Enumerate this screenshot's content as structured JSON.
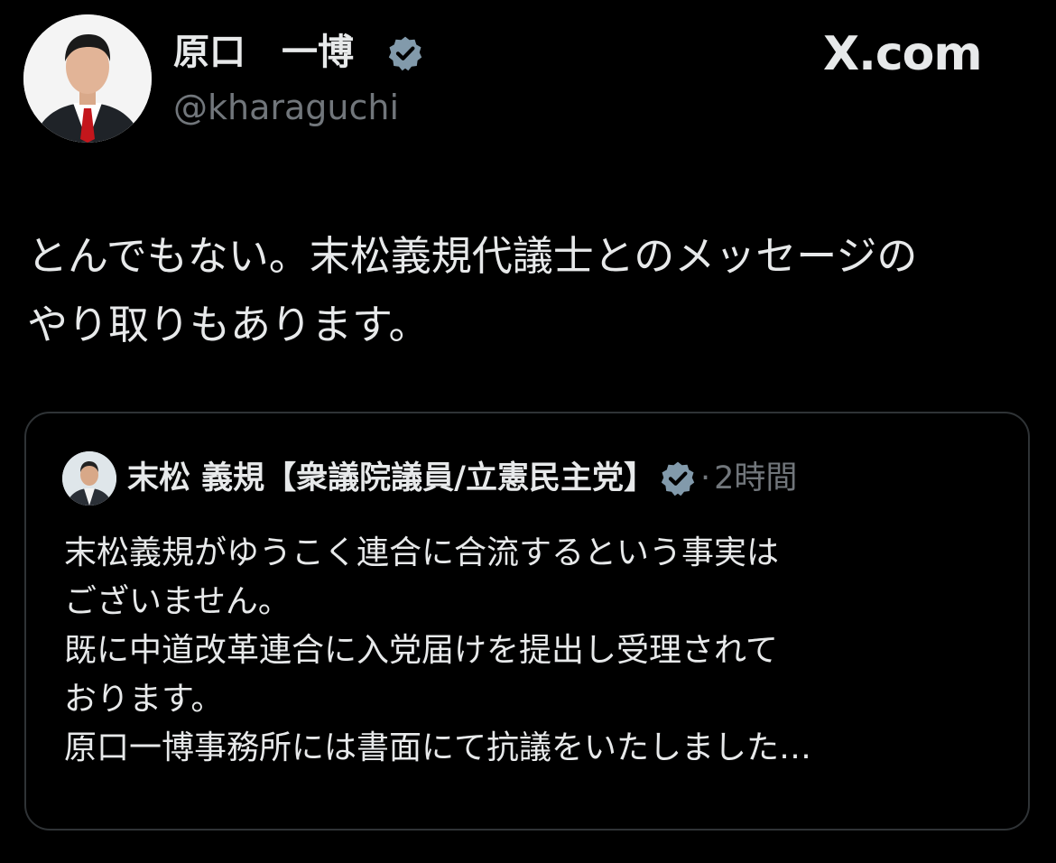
{
  "author": {
    "name": "原口　一博",
    "handle": "@kharaguchi",
    "avatar": "portrait-photo"
  },
  "site": {
    "brand": "X.com"
  },
  "tweet": {
    "text": "とんでもない。末松義規代議士とのメッセージの\nやり取りもあります。"
  },
  "quote": {
    "name": "末松 義規【衆議院議員/立憲民主党】",
    "separator": "·",
    "time": "2時間",
    "avatar": "portrait-photo",
    "body": "末松義規がゆうこく連合に合流するという事実は\nございません。\n既に中道改革連合に入党届けを提出し受理されて\nおります。\n原口一博事務所には書面にて抗議をいたしました…"
  },
  "icons": {
    "verified": "verified-badge-icon"
  },
  "colors": {
    "background": "#000000",
    "text": "#e7e9ea",
    "secondary": "#71767b",
    "border": "#2f3336",
    "badge": "#829aab"
  }
}
